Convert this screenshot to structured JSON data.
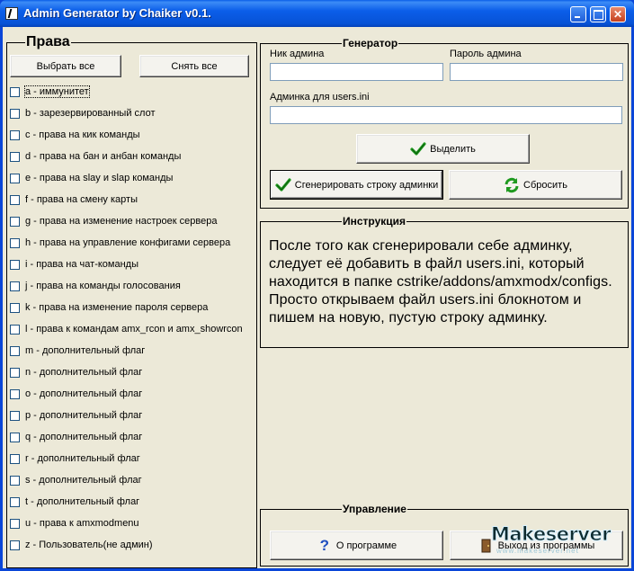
{
  "window": {
    "title": "Admin Generator by Chaiker v0.1."
  },
  "prava": {
    "title": "Права",
    "select_all": "Выбрать все",
    "clear_all": "Снять все",
    "flags": [
      "a - иммунитет",
      "b - зарезервированный слот",
      "c - права на кик команды",
      "d - права на бан и анбан команды",
      "e - права на slay и slap команды",
      "f - права на смену карты",
      "g - права на изменение настроек сервера",
      "h - права на управление конфигами сервера",
      "i - права на чат-команды",
      "j - права на команды голосования",
      "k - права на изменение пароля сервера",
      "l - права к командам amx_rcon и amx_showrcon",
      "m - дополнительный флаг",
      "n - дополнительный флаг",
      "o - дополнительный флаг",
      "p - дополнительный флаг",
      "q - дополнительный флаг",
      "r - дополнительный флаг",
      "s - дополнительный флаг",
      "t - дополнительный флаг",
      "u - права к amxmodmenu",
      "z - Пользователь(не админ)"
    ]
  },
  "generator": {
    "title": "Генератор",
    "nick_label": "Ник админа",
    "nick_value": "",
    "password_label": "Пароль админа",
    "password_value": "",
    "users_label": "Админка для users.ini",
    "users_value": "",
    "select_button": "Выделить",
    "generate_button": "Сгенерировать строку админки",
    "reset_button": "Сбросить"
  },
  "instruction": {
    "title": "Инструкция",
    "text": "После того как сгенерировали себе админку, следует её добавить в файл users.ini, который находится в папке cstrike/addons/amxmodx/configs. Просто открываем файл users.ini блокнотом и пишем на новую, пустую строку админку."
  },
  "control": {
    "title": "Управление",
    "about_button": "О программе",
    "exit_button": "Выход из программы"
  },
  "watermark": {
    "main": "Makeserver",
    "sub": "www.makeserver.net"
  },
  "colors": {
    "titlebar": "#0a5fe8",
    "face": "#ece9d8",
    "check_green": "#1f9a1f"
  }
}
